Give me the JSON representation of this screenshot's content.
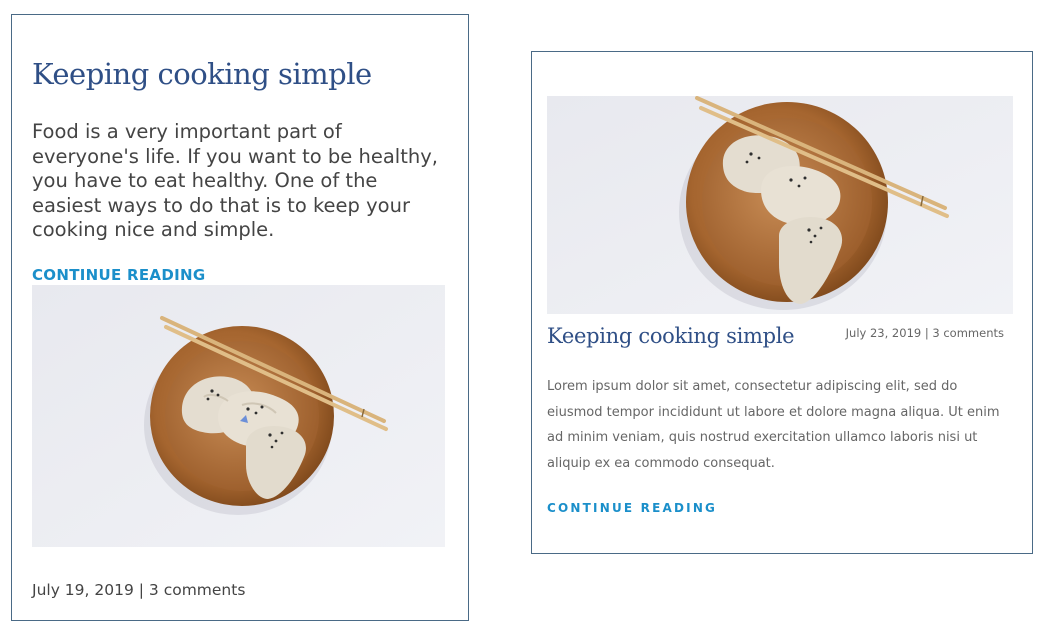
{
  "card_1": {
    "title": "Keeping cooking simple",
    "excerpt": "Food is a very important part of everyone's life. If you want to be healthy, you have to eat healthy. One of the easiest ways to do that is to keep your cooking nice and simple.",
    "link": "CONTINUE READING",
    "meta": "July 19, 2019 | 3 comments",
    "image": "dumplings-on-wooden-plate-with-chopsticks"
  },
  "card_2": {
    "title": "Keeping cooking simple",
    "meta": "July 23, 2019 | 3 comments",
    "excerpt": "Lorem ipsum dolor sit amet, consectetur adipiscing elit, sed do eiusmod tempor incididunt ut labore et dolore magna aliqua. Ut enim ad minim veniam, quis nostrud exercitation ullamco laboris nisi ut aliquip ex ea commodo consequat.",
    "link": "CONTINUE READING",
    "image": "dumplings-on-wooden-plate-with-chopsticks"
  },
  "colors": {
    "border": "#4a6a86",
    "title": "#2f4f86",
    "link": "#1b8fca",
    "text": "#444444"
  }
}
